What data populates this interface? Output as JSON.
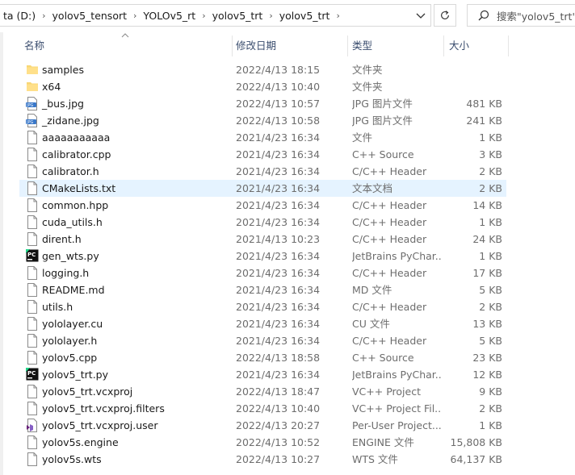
{
  "address": {
    "crumbs": [
      "ta (D:)",
      "yolov5_tensort",
      "YOLOv5_rt",
      "yolov5_trt",
      "yolov5_trt"
    ]
  },
  "search": {
    "placeholder": "搜索\"yolov5_trt\""
  },
  "columns": {
    "name": "名称",
    "date": "修改日期",
    "type": "类型",
    "size": "大小"
  },
  "files": [
    {
      "name": "samples",
      "date": "2022/4/13 18:15",
      "type": "文件夹",
      "size": "",
      "icon": "folder"
    },
    {
      "name": "x64",
      "date": "2022/4/13 10:40",
      "type": "文件夹",
      "size": "",
      "icon": "folder"
    },
    {
      "name": "_bus.jpg",
      "date": "2022/4/13 10:57",
      "type": "JPG 图片文件",
      "size": "481 KB",
      "icon": "jpg"
    },
    {
      "name": "_zidane.jpg",
      "date": "2022/4/13 10:58",
      "type": "JPG 图片文件",
      "size": "241 KB",
      "icon": "jpg"
    },
    {
      "name": "aaaaaaaaaaa",
      "date": "2021/4/23 16:34",
      "type": "文件",
      "size": "1 KB",
      "icon": "file"
    },
    {
      "name": "calibrator.cpp",
      "date": "2021/4/23 16:34",
      "type": "C++ Source",
      "size": "3 KB",
      "icon": "file"
    },
    {
      "name": "calibrator.h",
      "date": "2021/4/23 16:34",
      "type": "C/C++ Header",
      "size": "2 KB",
      "icon": "file"
    },
    {
      "name": "CMakeLists.txt",
      "date": "2021/4/23 16:34",
      "type": "文本文档",
      "size": "2 KB",
      "icon": "file",
      "selected": true
    },
    {
      "name": "common.hpp",
      "date": "2021/4/23 16:34",
      "type": "C/C++ Header",
      "size": "14 KB",
      "icon": "file"
    },
    {
      "name": "cuda_utils.h",
      "date": "2021/4/23 16:34",
      "type": "C/C++ Header",
      "size": "1 KB",
      "icon": "file"
    },
    {
      "name": "dirent.h",
      "date": "2021/4/13 10:23",
      "type": "C/C++ Header",
      "size": "24 KB",
      "icon": "file"
    },
    {
      "name": "gen_wts.py",
      "date": "2021/4/23 16:34",
      "type": "JetBrains PyChar...",
      "size": "1 KB",
      "icon": "pycharm"
    },
    {
      "name": "logging.h",
      "date": "2021/4/23 16:34",
      "type": "C/C++ Header",
      "size": "17 KB",
      "icon": "file"
    },
    {
      "name": "README.md",
      "date": "2021/4/23 16:34",
      "type": "MD 文件",
      "size": "5 KB",
      "icon": "file"
    },
    {
      "name": "utils.h",
      "date": "2021/4/23 16:34",
      "type": "C/C++ Header",
      "size": "2 KB",
      "icon": "file"
    },
    {
      "name": "yololayer.cu",
      "date": "2021/4/23 16:34",
      "type": "CU 文件",
      "size": "13 KB",
      "icon": "file"
    },
    {
      "name": "yololayer.h",
      "date": "2021/4/23 16:34",
      "type": "C/C++ Header",
      "size": "5 KB",
      "icon": "file"
    },
    {
      "name": "yolov5.cpp",
      "date": "2022/4/13 18:58",
      "type": "C++ Source",
      "size": "23 KB",
      "icon": "file"
    },
    {
      "name": "yolov5_trt.py",
      "date": "2021/4/23 16:34",
      "type": "JetBrains PyChar...",
      "size": "12 KB",
      "icon": "pycharm"
    },
    {
      "name": "yolov5_trt.vcxproj",
      "date": "2022/4/13 18:47",
      "type": "VC++ Project",
      "size": "9 KB",
      "icon": "file"
    },
    {
      "name": "yolov5_trt.vcxproj.filters",
      "date": "2022/4/13 10:40",
      "type": "VC++ Project Fil...",
      "size": "2 KB",
      "icon": "file"
    },
    {
      "name": "yolov5_trt.vcxproj.user",
      "date": "2022/4/13 20:27",
      "type": "Per-User Project...",
      "size": "1 KB",
      "icon": "vsuser"
    },
    {
      "name": "yolov5s.engine",
      "date": "2022/4/13 10:52",
      "type": "ENGINE 文件",
      "size": "15,808 KB",
      "icon": "file"
    },
    {
      "name": "yolov5s.wts",
      "date": "2022/4/13 10:27",
      "type": "WTS 文件",
      "size": "64,137 KB",
      "icon": "file"
    }
  ]
}
